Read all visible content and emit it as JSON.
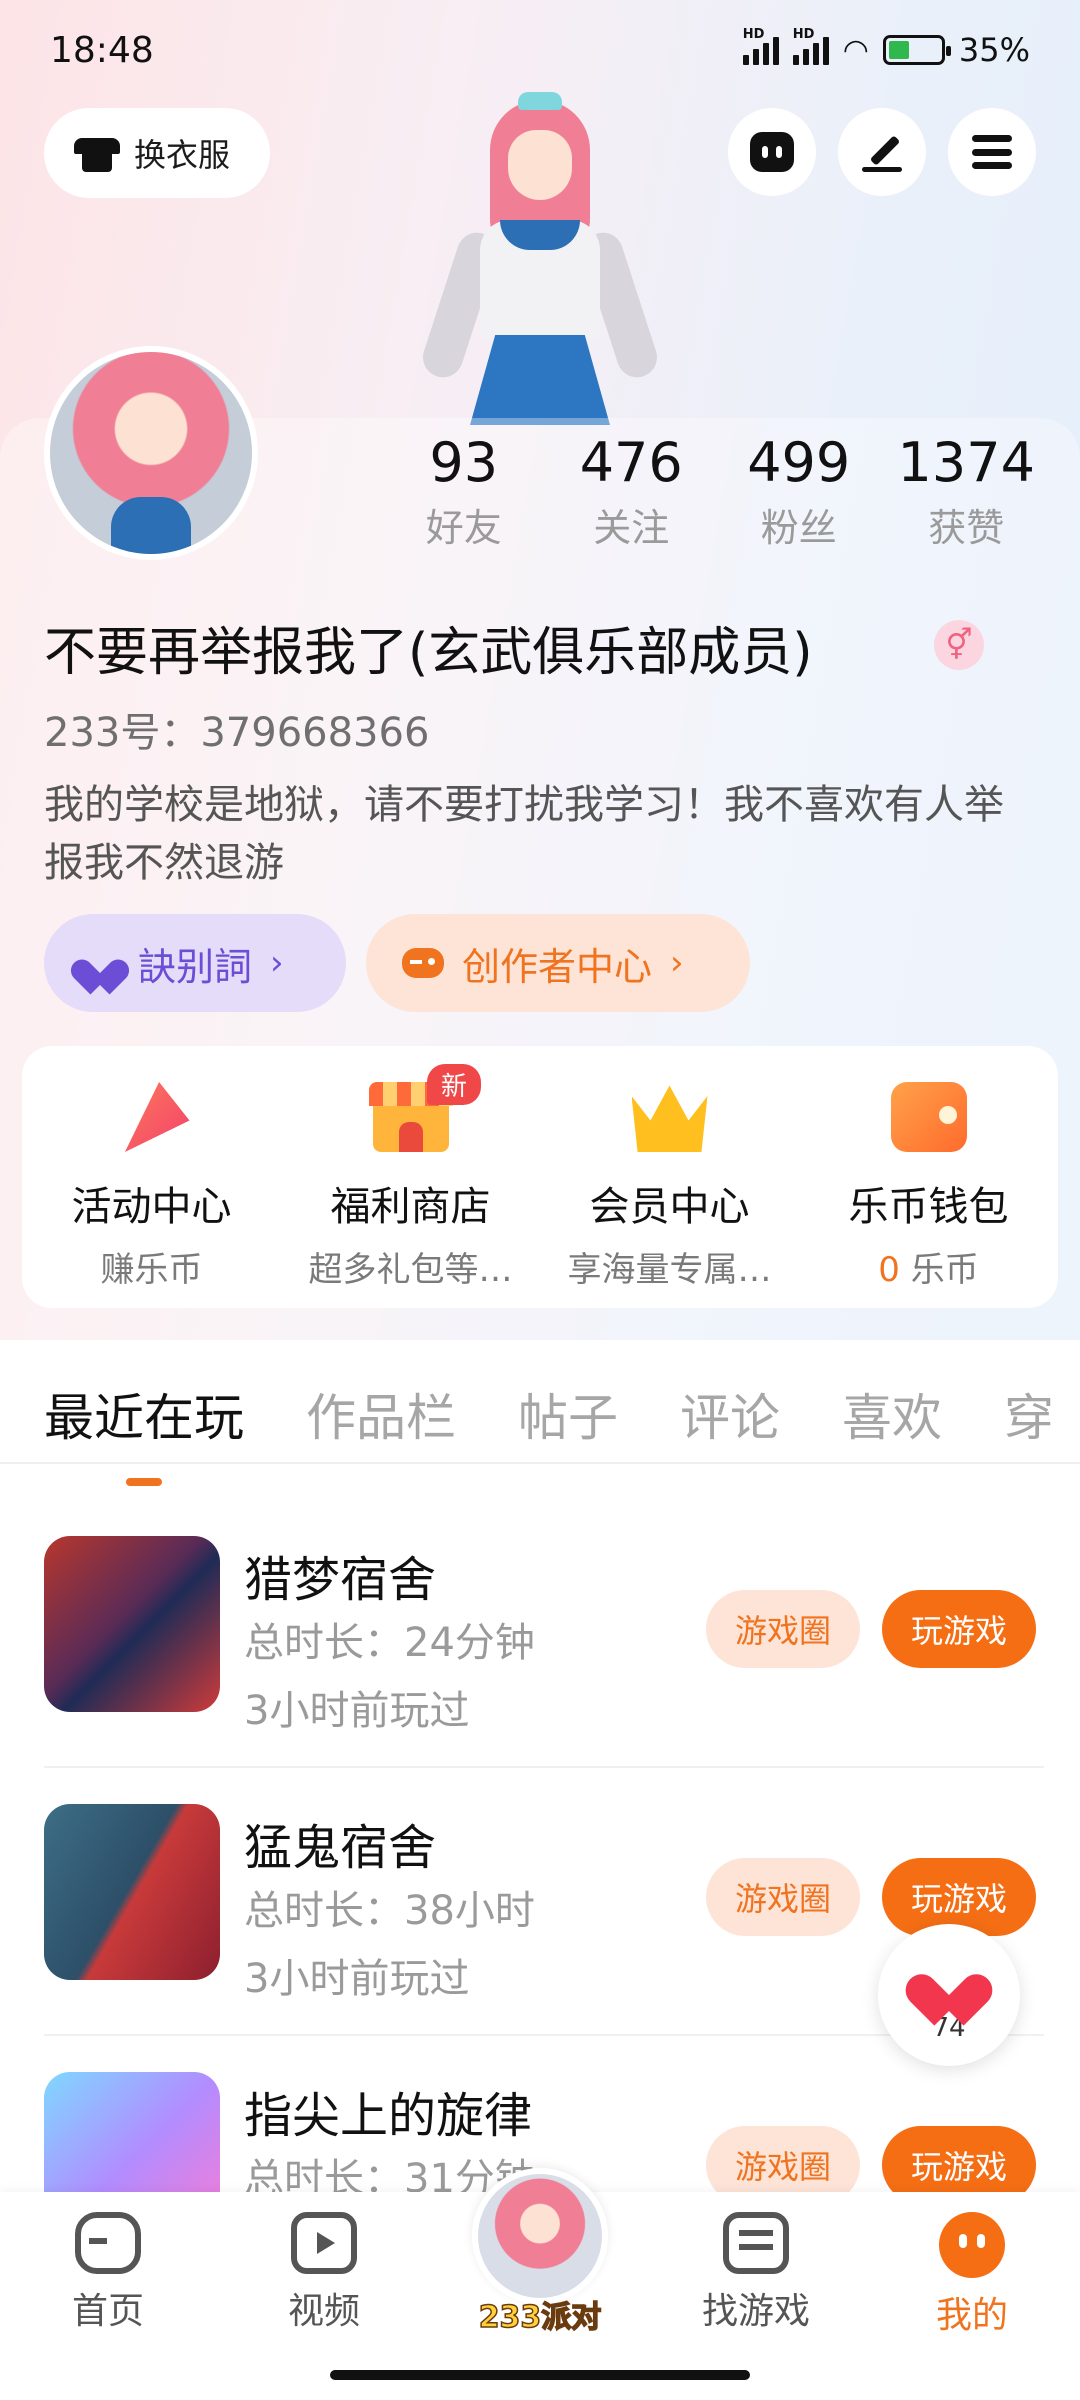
{
  "status_bar": {
    "time": "18:48",
    "battery_percent": "35%"
  },
  "top_actions": {
    "dress_label": "换衣服"
  },
  "profile": {
    "username": "不要再举报我了(玄武俱乐部成员)",
    "gender_symbol": "⚥",
    "user_id": "233号：379668366",
    "bio": "我的学校是地狱，请不要打扰我学习！我不喜欢有人举报我不然退游",
    "stats": [
      {
        "value": "93",
        "label": "好友"
      },
      {
        "value": "476",
        "label": "关注"
      },
      {
        "value": "499",
        "label": "粉丝"
      },
      {
        "value": "1374",
        "label": "获赞"
      }
    ],
    "cp_label": "訣别詞",
    "creator_label": "创作者中心",
    "chevron": "›"
  },
  "quick_links": [
    {
      "title": "活动中心",
      "sub": "赚乐币"
    },
    {
      "title": "福利商店",
      "sub": "超多礼包等…",
      "badge": "新"
    },
    {
      "title": "会员中心",
      "sub": "享海量专属…"
    },
    {
      "title": "乐币钱包",
      "sub_count": "0",
      "sub": "乐币"
    }
  ],
  "tabs": [
    "最近在玩",
    "作品栏",
    "帖子",
    "评论",
    "喜欢",
    "穿"
  ],
  "games": [
    {
      "name": "猎梦宿舍",
      "time": "总时长：24分钟",
      "last": "3小时前玩过"
    },
    {
      "name": "猛鬼宿舍",
      "time": "总时长：38小时",
      "last": "3小时前玩过"
    },
    {
      "name": "指尖上的旋律",
      "time": "总时长：31分钟",
      "last": ""
    }
  ],
  "game_buttons": {
    "circle": "游戏圈",
    "play": "玩游戏"
  },
  "like_float": {
    "count": "74"
  },
  "bottom_nav": {
    "items": [
      {
        "label": "首页"
      },
      {
        "label": "视频"
      },
      {
        "label": "找游戏"
      },
      {
        "label": "我的"
      }
    ],
    "center_label": "233派对"
  },
  "colors": {
    "accent": "#f56e14",
    "purple": "#6b4dd6",
    "like": "#f2364e"
  }
}
